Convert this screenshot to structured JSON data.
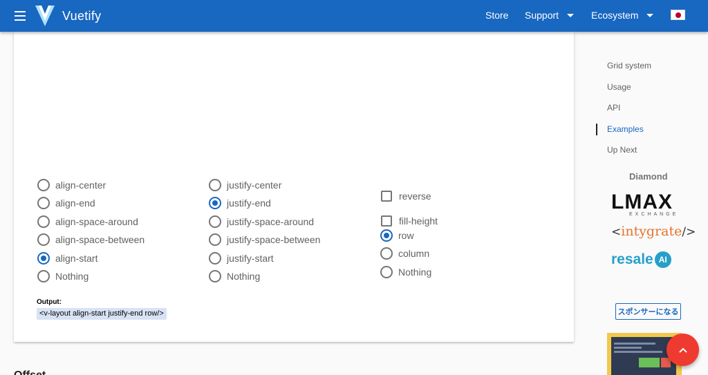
{
  "appbar": {
    "brand": "Vuetify",
    "nav": {
      "store": "Store",
      "support": "Support",
      "ecosystem": "Ecosystem"
    },
    "flag": "japan-flag-icon",
    "color": "#1867c0"
  },
  "demo": {
    "align_options": [
      {
        "label": "align-center",
        "selected": false
      },
      {
        "label": "align-end",
        "selected": false
      },
      {
        "label": "align-space-around",
        "selected": false
      },
      {
        "label": "align-space-between",
        "selected": false
      },
      {
        "label": "align-start",
        "selected": true
      },
      {
        "label": "Nothing",
        "selected": false
      }
    ],
    "justify_options": [
      {
        "label": "justify-center",
        "selected": false
      },
      {
        "label": "justify-end",
        "selected": true
      },
      {
        "label": "justify-space-around",
        "selected": false
      },
      {
        "label": "justify-space-between",
        "selected": false
      },
      {
        "label": "justify-start",
        "selected": false
      },
      {
        "label": "Nothing",
        "selected": false
      }
    ],
    "checkboxes": [
      {
        "label": "reverse",
        "checked": false
      },
      {
        "label": "fill-height",
        "checked": false
      }
    ],
    "direction_options": [
      {
        "label": "row",
        "selected": true
      },
      {
        "label": "column",
        "selected": false
      },
      {
        "label": "Nothing",
        "selected": false
      }
    ],
    "output_label": "Output:",
    "output_code": "<v-layout align-start justify-end row/>"
  },
  "next_section_title": "Offset",
  "toc": {
    "items": [
      "Grid system",
      "Usage",
      "API",
      "Examples",
      "Up Next"
    ],
    "active": "Examples"
  },
  "sponsors": {
    "tier": "Diamond",
    "lmax_top": "LMAX",
    "lmax_bottom": "EXCHANGE",
    "intygrate": "intygrate",
    "resale": "resale",
    "resale_badge": "AI",
    "sponsor_button": "スポンサーになる"
  },
  "fab_icon": "chevron-up-icon"
}
